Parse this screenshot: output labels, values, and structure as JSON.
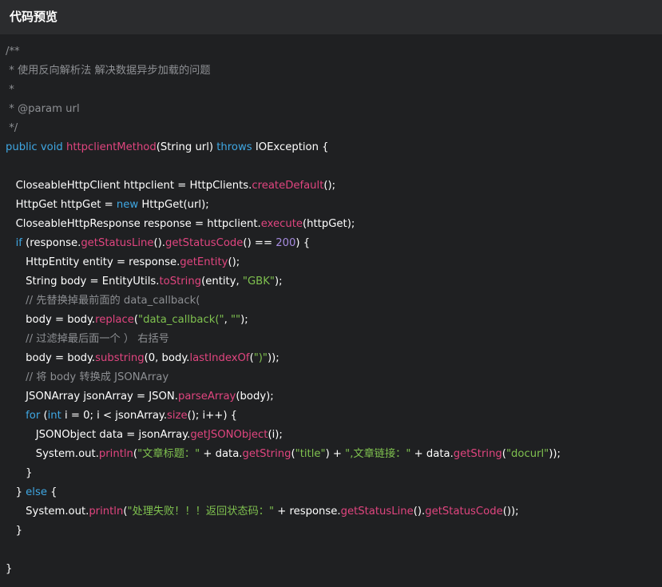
{
  "header": {
    "title": "代码预览"
  },
  "colors": {
    "background": "#1f2022",
    "header_background": "#2b2c2e",
    "plain": "#ffffff",
    "keyword": "#3fa7e3",
    "method": "#e0457f",
    "string": "#7fc14f",
    "number": "#a78ce0",
    "comment": "#8d8f93"
  },
  "code": {
    "lines": [
      [
        [
          "c",
          "/**"
        ]
      ],
      [
        [
          "c",
          " * 使用反向解析法 解决数据异步加载的问题"
        ]
      ],
      [
        [
          "c",
          " *"
        ]
      ],
      [
        [
          "c",
          " * @param url"
        ]
      ],
      [
        [
          "c",
          " */"
        ]
      ],
      [
        [
          "k",
          "public void "
        ],
        [
          "m",
          "httpclientMethod"
        ],
        [
          "p",
          "(String url) "
        ],
        [
          "k",
          "throws "
        ],
        [
          "p",
          "IOException {"
        ]
      ],
      [],
      [
        [
          "p",
          "   CloseableHttpClient httpclient = HttpClients."
        ],
        [
          "m",
          "createDefault"
        ],
        [
          "p",
          "();"
        ]
      ],
      [
        [
          "p",
          "   HttpGet httpGet = "
        ],
        [
          "k",
          "new "
        ],
        [
          "p",
          "HttpGet(url);"
        ]
      ],
      [
        [
          "p",
          "   CloseableHttpResponse response = httpclient."
        ],
        [
          "m",
          "execute"
        ],
        [
          "p",
          "(httpGet);"
        ]
      ],
      [
        [
          "k",
          "   if "
        ],
        [
          "p",
          "(response."
        ],
        [
          "m",
          "getStatusLine"
        ],
        [
          "p",
          "()."
        ],
        [
          "m",
          "getStatusCode"
        ],
        [
          "p",
          "() == "
        ],
        [
          "n",
          "200"
        ],
        [
          "p",
          ") {"
        ]
      ],
      [
        [
          "p",
          "      HttpEntity entity = response."
        ],
        [
          "m",
          "getEntity"
        ],
        [
          "p",
          "();"
        ]
      ],
      [
        [
          "p",
          "      String body = EntityUtils."
        ],
        [
          "m",
          "toString"
        ],
        [
          "p",
          "(entity, "
        ],
        [
          "s",
          "\"GBK\""
        ],
        [
          "p",
          ");"
        ]
      ],
      [
        [
          "c",
          "      // 先替换掉最前面的 data_callback("
        ]
      ],
      [
        [
          "p",
          "      body = body."
        ],
        [
          "m",
          "replace"
        ],
        [
          "p",
          "("
        ],
        [
          "s",
          "\"data_callback(\""
        ],
        [
          "p",
          ", "
        ],
        [
          "s",
          "\"\""
        ],
        [
          "p",
          ");"
        ]
      ],
      [
        [
          "c",
          "      // 过滤掉最后面一个 ） 右括号"
        ]
      ],
      [
        [
          "p",
          "      body = body."
        ],
        [
          "m",
          "substring"
        ],
        [
          "p",
          "(0, body."
        ],
        [
          "m",
          "lastIndexOf"
        ],
        [
          "p",
          "("
        ],
        [
          "s",
          "\")\""
        ],
        [
          "p",
          "));"
        ]
      ],
      [
        [
          "c",
          "      // 将 body 转换成 JSONArray"
        ]
      ],
      [
        [
          "p",
          "      JSONArray jsonArray = JSON."
        ],
        [
          "m",
          "parseArray"
        ],
        [
          "p",
          "(body);"
        ]
      ],
      [
        [
          "k",
          "      for "
        ],
        [
          "p",
          "("
        ],
        [
          "k",
          "int "
        ],
        [
          "p",
          "i = 0; i < jsonArray."
        ],
        [
          "m",
          "size"
        ],
        [
          "p",
          "(); i++) {"
        ]
      ],
      [
        [
          "p",
          "         JSONObject data = jsonArray."
        ],
        [
          "m",
          "getJSONObject"
        ],
        [
          "p",
          "(i);"
        ]
      ],
      [
        [
          "p",
          "         System.out."
        ],
        [
          "m",
          "println"
        ],
        [
          "p",
          "("
        ],
        [
          "s",
          "\"文章标题：\""
        ],
        [
          "p",
          " + data."
        ],
        [
          "m",
          "getString"
        ],
        [
          "p",
          "("
        ],
        [
          "s",
          "\"title\""
        ],
        [
          "p",
          ") + "
        ],
        [
          "s",
          "\",文章链接：\""
        ],
        [
          "p",
          " + data."
        ],
        [
          "m",
          "getString"
        ],
        [
          "p",
          "("
        ],
        [
          "s",
          "\"docurl\""
        ],
        [
          "p",
          "));"
        ]
      ],
      [
        [
          "p",
          "      }"
        ]
      ],
      [
        [
          "p",
          "   } "
        ],
        [
          "k",
          "else "
        ],
        [
          "p",
          "{"
        ]
      ],
      [
        [
          "p",
          "      System.out."
        ],
        [
          "m",
          "println"
        ],
        [
          "p",
          "("
        ],
        [
          "s",
          "\"处理失败！！！返回状态码：\""
        ],
        [
          "p",
          " + response."
        ],
        [
          "m",
          "getStatusLine"
        ],
        [
          "p",
          "()."
        ],
        [
          "m",
          "getStatusCode"
        ],
        [
          "p",
          "());"
        ]
      ],
      [
        [
          "p",
          "   }"
        ]
      ],
      [],
      [
        [
          "p",
          "}"
        ]
      ]
    ]
  }
}
